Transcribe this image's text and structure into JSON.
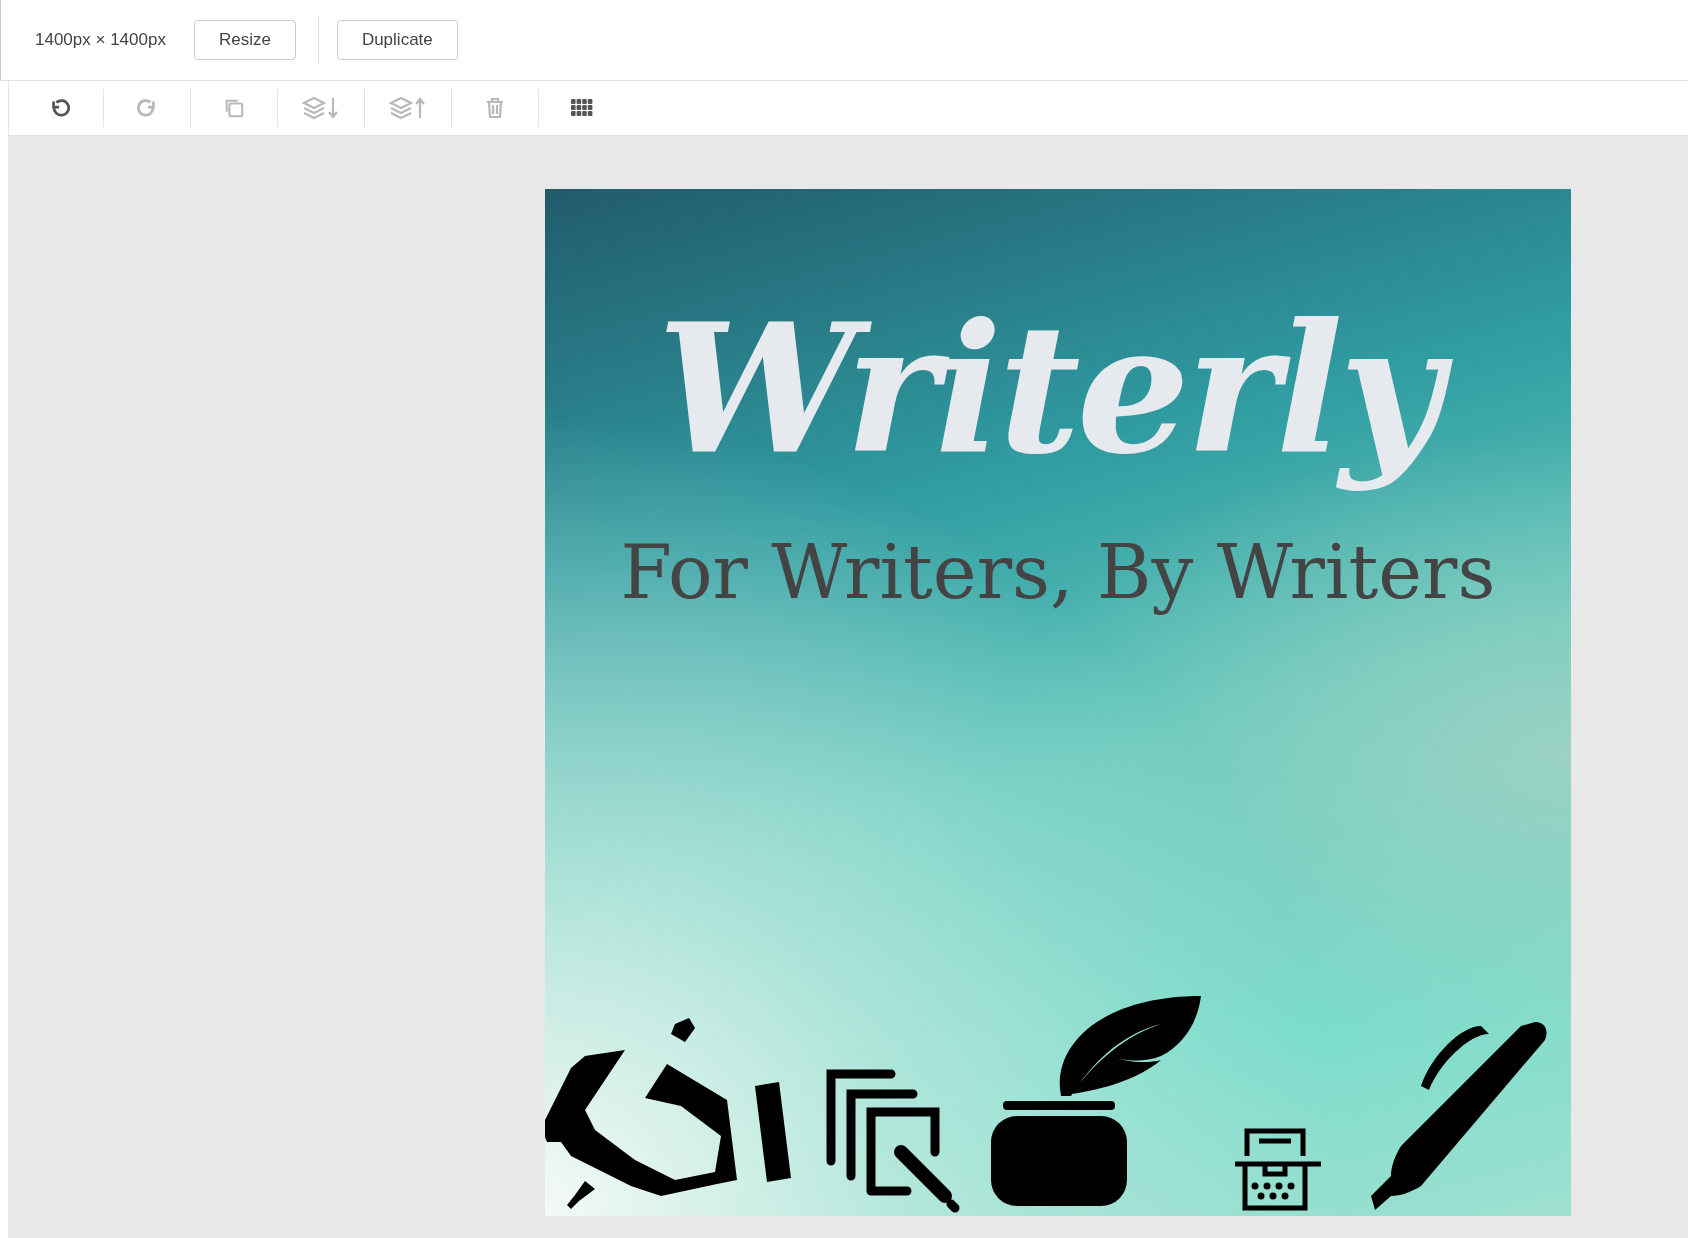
{
  "top_bar": {
    "dimensions": "1400px × 1400px",
    "buttons": [
      "Resize",
      "Duplicate"
    ]
  },
  "toolbar": [
    {
      "kind": "undo",
      "disabled": false
    },
    {
      "kind": "redo",
      "disabled": true
    },
    {
      "kind": "copy",
      "disabled": true
    },
    {
      "kind": "send-backward",
      "disabled": true
    },
    {
      "kind": "bring-forward",
      "disabled": true
    },
    {
      "kind": "delete",
      "disabled": true
    },
    {
      "kind": "grid",
      "disabled": false
    }
  ],
  "design": {
    "title": "Writerly",
    "subtitle": "For Writers, By Writers",
    "icons": [
      {
        "kind": "hand-pen"
      },
      {
        "kind": "documents"
      },
      {
        "kind": "inkwell"
      },
      {
        "kind": "typewriter"
      },
      {
        "kind": "pen"
      }
    ]
  }
}
